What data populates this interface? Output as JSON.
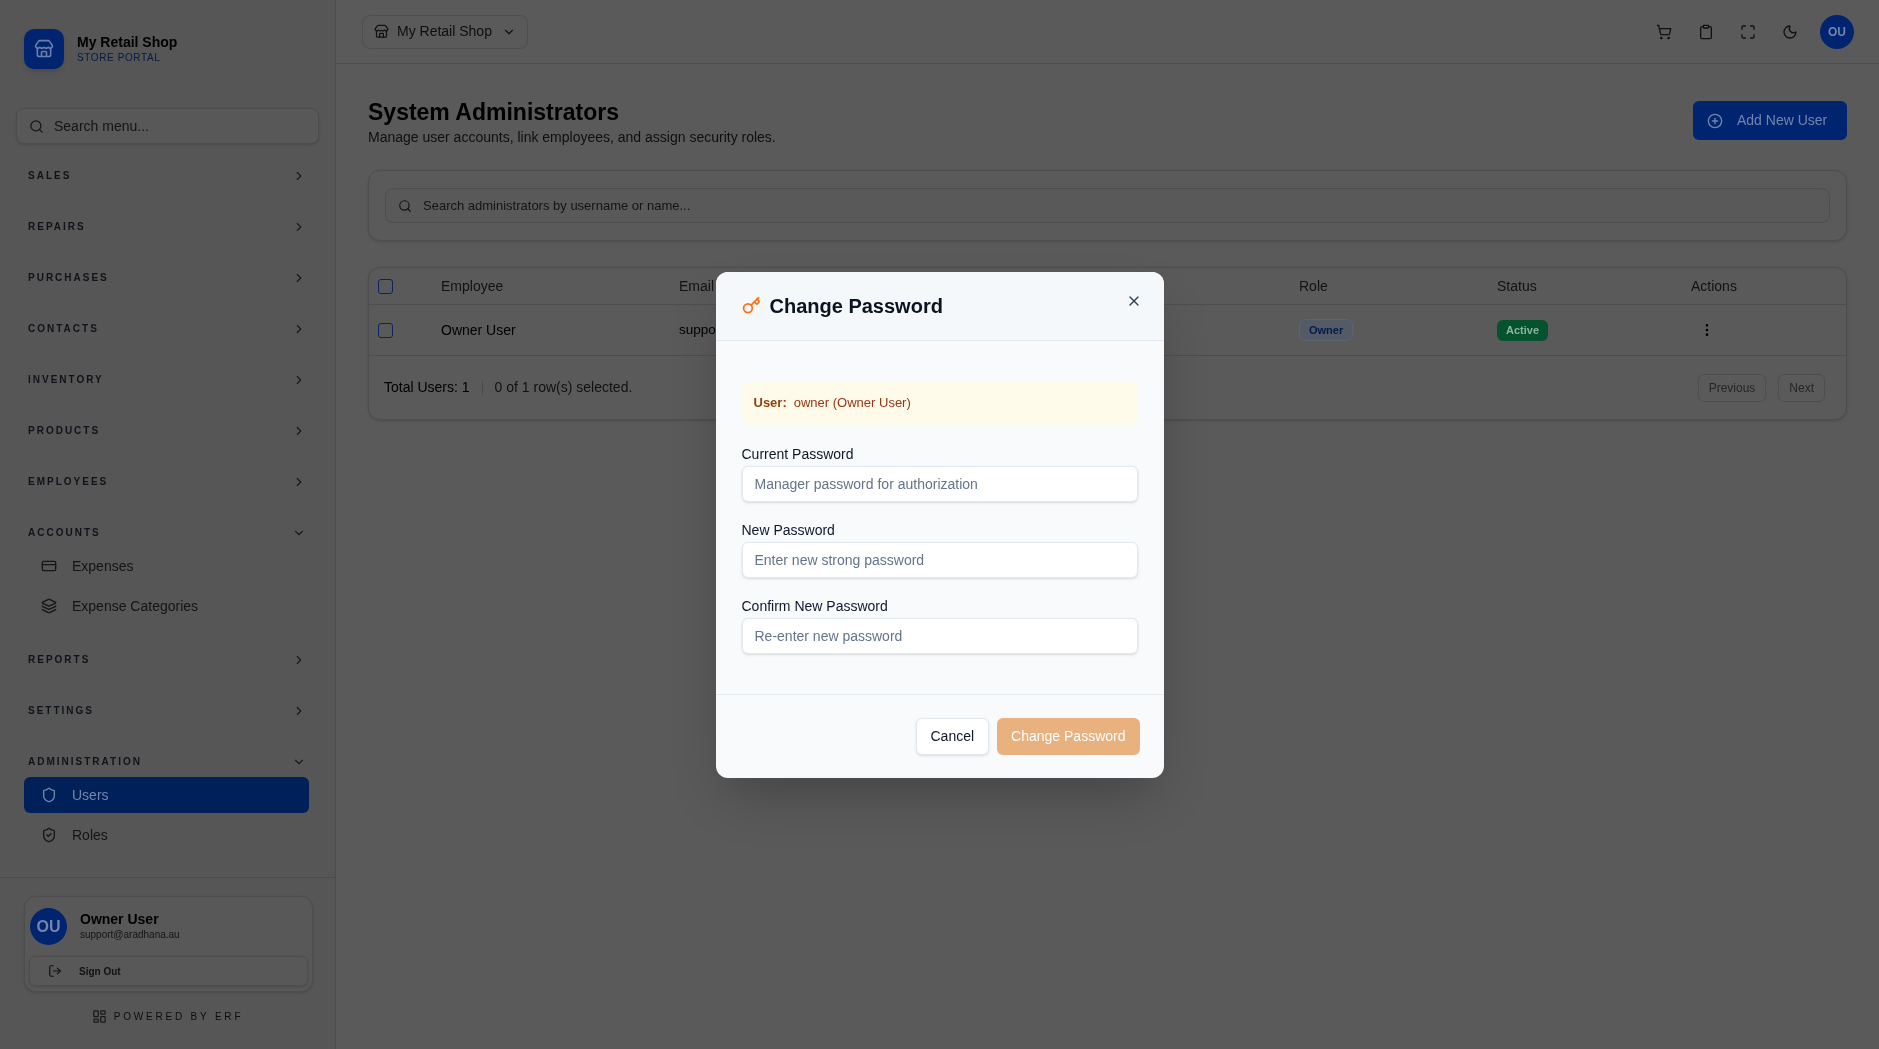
{
  "sidebar": {
    "brand": {
      "title": "My Retail Shop",
      "subtitle": "STORE PORTAL"
    },
    "search": {
      "placeholder": "Search menu..."
    },
    "sections": [
      {
        "label": "SALES",
        "expanded": false
      },
      {
        "label": "REPAIRS",
        "expanded": false
      },
      {
        "label": "PURCHASES",
        "expanded": false
      },
      {
        "label": "CONTACTS",
        "expanded": false
      },
      {
        "label": "INVENTORY",
        "expanded": false
      },
      {
        "label": "PRODUCTS",
        "expanded": false
      },
      {
        "label": "EMPLOYEES",
        "expanded": false
      },
      {
        "label": "ACCOUNTS",
        "expanded": true,
        "items": [
          {
            "label": "Expenses",
            "selected": false
          },
          {
            "label": "Expense Categories",
            "selected": false
          }
        ]
      },
      {
        "label": "REPORTS",
        "expanded": false
      },
      {
        "label": "SETTINGS",
        "expanded": false
      },
      {
        "label": "ADMINISTRATION",
        "expanded": true,
        "items": [
          {
            "label": "Users",
            "selected": true
          },
          {
            "label": "Roles",
            "selected": false
          }
        ]
      }
    ],
    "user": {
      "initials": "OU",
      "name": "Owner User",
      "email": "support@aradhana.au"
    },
    "sign_out": "Sign Out",
    "footer": "POWERED BY ERF"
  },
  "topbar": {
    "shop_selector": "My Retail Shop",
    "avatar": "OU"
  },
  "page": {
    "title": "System Administrators",
    "subtitle": "Manage user accounts, link employees, and assign security roles.",
    "add_button": "Add New User",
    "search": {
      "placeholder": "Search administrators by username or name..."
    }
  },
  "table": {
    "select_all_checked": false,
    "columns": [
      "Employee",
      "Email",
      "Role",
      "Status",
      "Actions"
    ],
    "rows": [
      {
        "checked": false,
        "employee": "Owner User",
        "email": "suppo",
        "role": "Owner",
        "status": "Active"
      }
    ],
    "total": "Total Users: 1",
    "selection": "0 of 1 row(s) selected.",
    "pagination": [
      {
        "label": "Previous",
        "disabled": true
      },
      {
        "label": "Next",
        "disabled": true
      }
    ]
  },
  "dialog": {
    "title": "Change Password",
    "user_label": "User:",
    "user_value": "owner (Owner User)",
    "fields": [
      {
        "label": "Current Password",
        "placeholder": "Manager password for authorization"
      },
      {
        "label": "New Password",
        "placeholder": "Enter new strong password"
      },
      {
        "label": "Confirm New Password",
        "placeholder": "Re-enter new password"
      }
    ],
    "buttons": [
      {
        "label": "Cancel",
        "kind": "secondary",
        "disabled": false
      },
      {
        "label": "Change Password",
        "kind": "primary",
        "disabled": true
      }
    ]
  }
}
